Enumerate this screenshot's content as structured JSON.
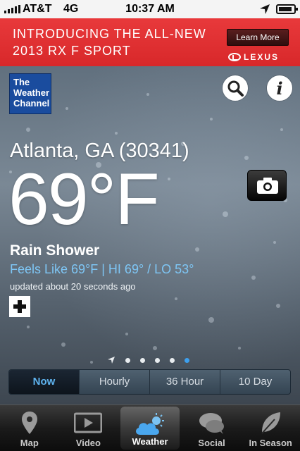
{
  "status_bar": {
    "carrier": "AT&T",
    "network": "4G",
    "time": "10:37 AM"
  },
  "ad": {
    "line1": "INTRODUCING THE ALL-NEW",
    "line2": "2013 RX F SPORT",
    "cta": "Learn More",
    "brand": "LEXUS",
    "background_color": "#dd2e30"
  },
  "header": {
    "logo_text": "The Weather Channel",
    "logo_color": "#1a4c9e"
  },
  "weather": {
    "location": "Atlanta, GA (30341)",
    "temperature": "69°F",
    "condition": "Rain Shower",
    "feels_like": "Feels Like 69°F | HI 69° / LO 53°",
    "updated": "updated about 20 seconds ago"
  },
  "pager": {
    "count": 5,
    "active_index": 4
  },
  "forecast_tabs": [
    {
      "label": "Now",
      "active": true
    },
    {
      "label": "Hourly",
      "active": false
    },
    {
      "label": "36 Hour",
      "active": false
    },
    {
      "label": "10 Day",
      "active": false
    }
  ],
  "tab_bar": [
    {
      "label": "Map",
      "icon": "map-pin-icon",
      "active": false
    },
    {
      "label": "Video",
      "icon": "video-icon",
      "active": false
    },
    {
      "label": "Weather",
      "icon": "weather-cloud-sun-icon",
      "active": true
    },
    {
      "label": "Social",
      "icon": "social-bubbles-icon",
      "active": false
    },
    {
      "label": "In Season",
      "icon": "leaf-icon",
      "active": false
    }
  ],
  "colors": {
    "accent_blue": "#3da0ee",
    "feels_like_blue": "#7ec6f5"
  }
}
